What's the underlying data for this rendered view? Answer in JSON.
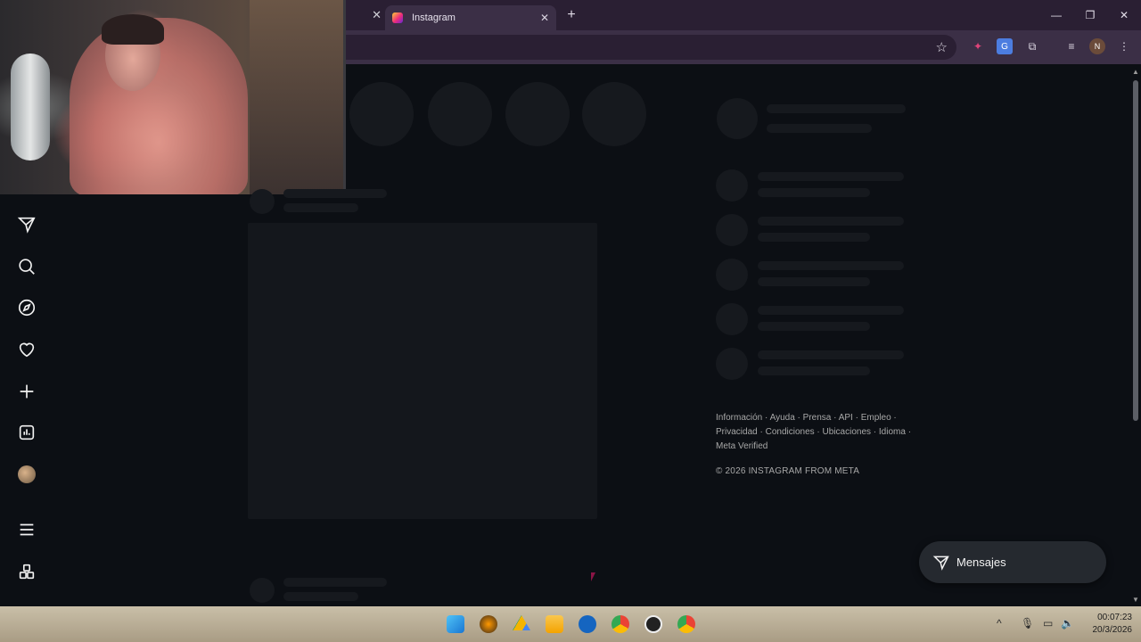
{
  "browser": {
    "tabs": [
      {
        "title": "",
        "close": "✕"
      },
      {
        "title": "Instagram",
        "close": "✕"
      }
    ],
    "new_tab": "+",
    "window_controls": {
      "minimize": "—",
      "maximize": "❐",
      "close": "✕"
    },
    "profile_initial": "N"
  },
  "sidebar": {
    "items": [
      {
        "name": "messages-icon"
      },
      {
        "name": "search-icon"
      },
      {
        "name": "explore-icon"
      },
      {
        "name": "notifications-icon"
      },
      {
        "name": "create-icon"
      },
      {
        "name": "dashboard-icon"
      },
      {
        "name": "profile-avatar"
      },
      {
        "name": "more-menu-icon"
      },
      {
        "name": "also-from-meta-icon"
      }
    ]
  },
  "footer": {
    "links_line1": [
      "Información",
      "Ayuda",
      "Prensa",
      "API",
      "Empleo"
    ],
    "links_line2": [
      "Privacidad",
      "Condiciones",
      "Ubicaciones",
      "Idioma"
    ],
    "links_line3": [
      "Meta Verified"
    ],
    "copyright": "© 2026 INSTAGRAM FROM META"
  },
  "messages_button": {
    "label": "Mensajes"
  },
  "taskbar": {
    "clock_time": "00:07:23",
    "clock_date": "20/3/2026",
    "tray_chevron": "^"
  },
  "colors": {
    "page_bg": "#0c0f14",
    "skeleton": "#16191e",
    "tab_strip": "#2a1f33",
    "toolbar": "#3b2f46",
    "messages_pill": "#25292f"
  }
}
